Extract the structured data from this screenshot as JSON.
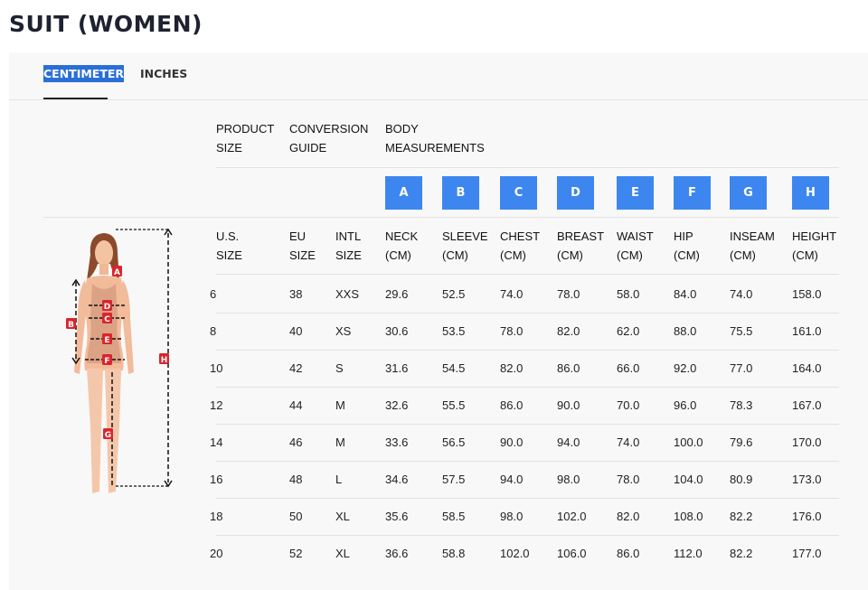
{
  "title": "SUIT (WOMEN)",
  "tabs": [
    {
      "label": "CENTIMETER",
      "active": true
    },
    {
      "label": "INCHES",
      "active": false
    }
  ],
  "headers": {
    "product_size": [
      "PRODUCT",
      "SIZE"
    ],
    "conversion_guide": [
      "CONVERSION",
      "GUIDE"
    ],
    "body_measurements": [
      "BODY",
      "MEASUREMENTS"
    ]
  },
  "badges": [
    "A",
    "B",
    "C",
    "D",
    "E",
    "F",
    "G",
    "H"
  ],
  "columns": [
    [
      "U.S.",
      "SIZE"
    ],
    [
      "EU",
      "SIZE"
    ],
    [
      "INTL",
      "SIZE"
    ],
    [
      "NECK",
      "(CM)"
    ],
    [
      "SLEEVE",
      "(CM)"
    ],
    [
      "CHEST",
      "(CM)"
    ],
    [
      "BREAST",
      "(CM)"
    ],
    [
      "WAIST",
      "(CM)"
    ],
    [
      "HIP",
      "(CM)"
    ],
    [
      "INSEAM",
      "(CM)"
    ],
    [
      "HEIGHT",
      "(CM)"
    ]
  ],
  "rows": [
    [
      "6",
      "38",
      "XXS",
      "29.6",
      "52.5",
      "74.0",
      "78.0",
      "58.0",
      "84.0",
      "74.0",
      "158.0"
    ],
    [
      "8",
      "40",
      "XS",
      "30.6",
      "53.5",
      "78.0",
      "82.0",
      "62.0",
      "88.0",
      "75.5",
      "161.0"
    ],
    [
      "10",
      "42",
      "S",
      "31.6",
      "54.5",
      "82.0",
      "86.0",
      "66.0",
      "92.0",
      "77.0",
      "164.0"
    ],
    [
      "12",
      "44",
      "M",
      "32.6",
      "55.5",
      "86.0",
      "90.0",
      "70.0",
      "96.0",
      "78.3",
      "167.0"
    ],
    [
      "14",
      "46",
      "M",
      "33.6",
      "56.5",
      "90.0",
      "94.0",
      "74.0",
      "100.0",
      "79.6",
      "170.0"
    ],
    [
      "16",
      "48",
      "L",
      "34.6",
      "57.5",
      "94.0",
      "98.0",
      "78.0",
      "104.0",
      "80.9",
      "173.0"
    ],
    [
      "18",
      "50",
      "XL",
      "35.6",
      "58.5",
      "98.0",
      "102.0",
      "82.0",
      "108.0",
      "82.2",
      "176.0"
    ],
    [
      "20",
      "52",
      "XL",
      "36.6",
      "58.8",
      "102.0",
      "106.0",
      "86.0",
      "112.0",
      "82.2",
      "177.0"
    ]
  ],
  "figure_markers": [
    "A",
    "B",
    "C",
    "D",
    "E",
    "F",
    "G",
    "H"
  ],
  "colors": {
    "accent": "#3d86f0",
    "tab_highlight": "#2a6fd6",
    "marker": "#d9262c"
  }
}
